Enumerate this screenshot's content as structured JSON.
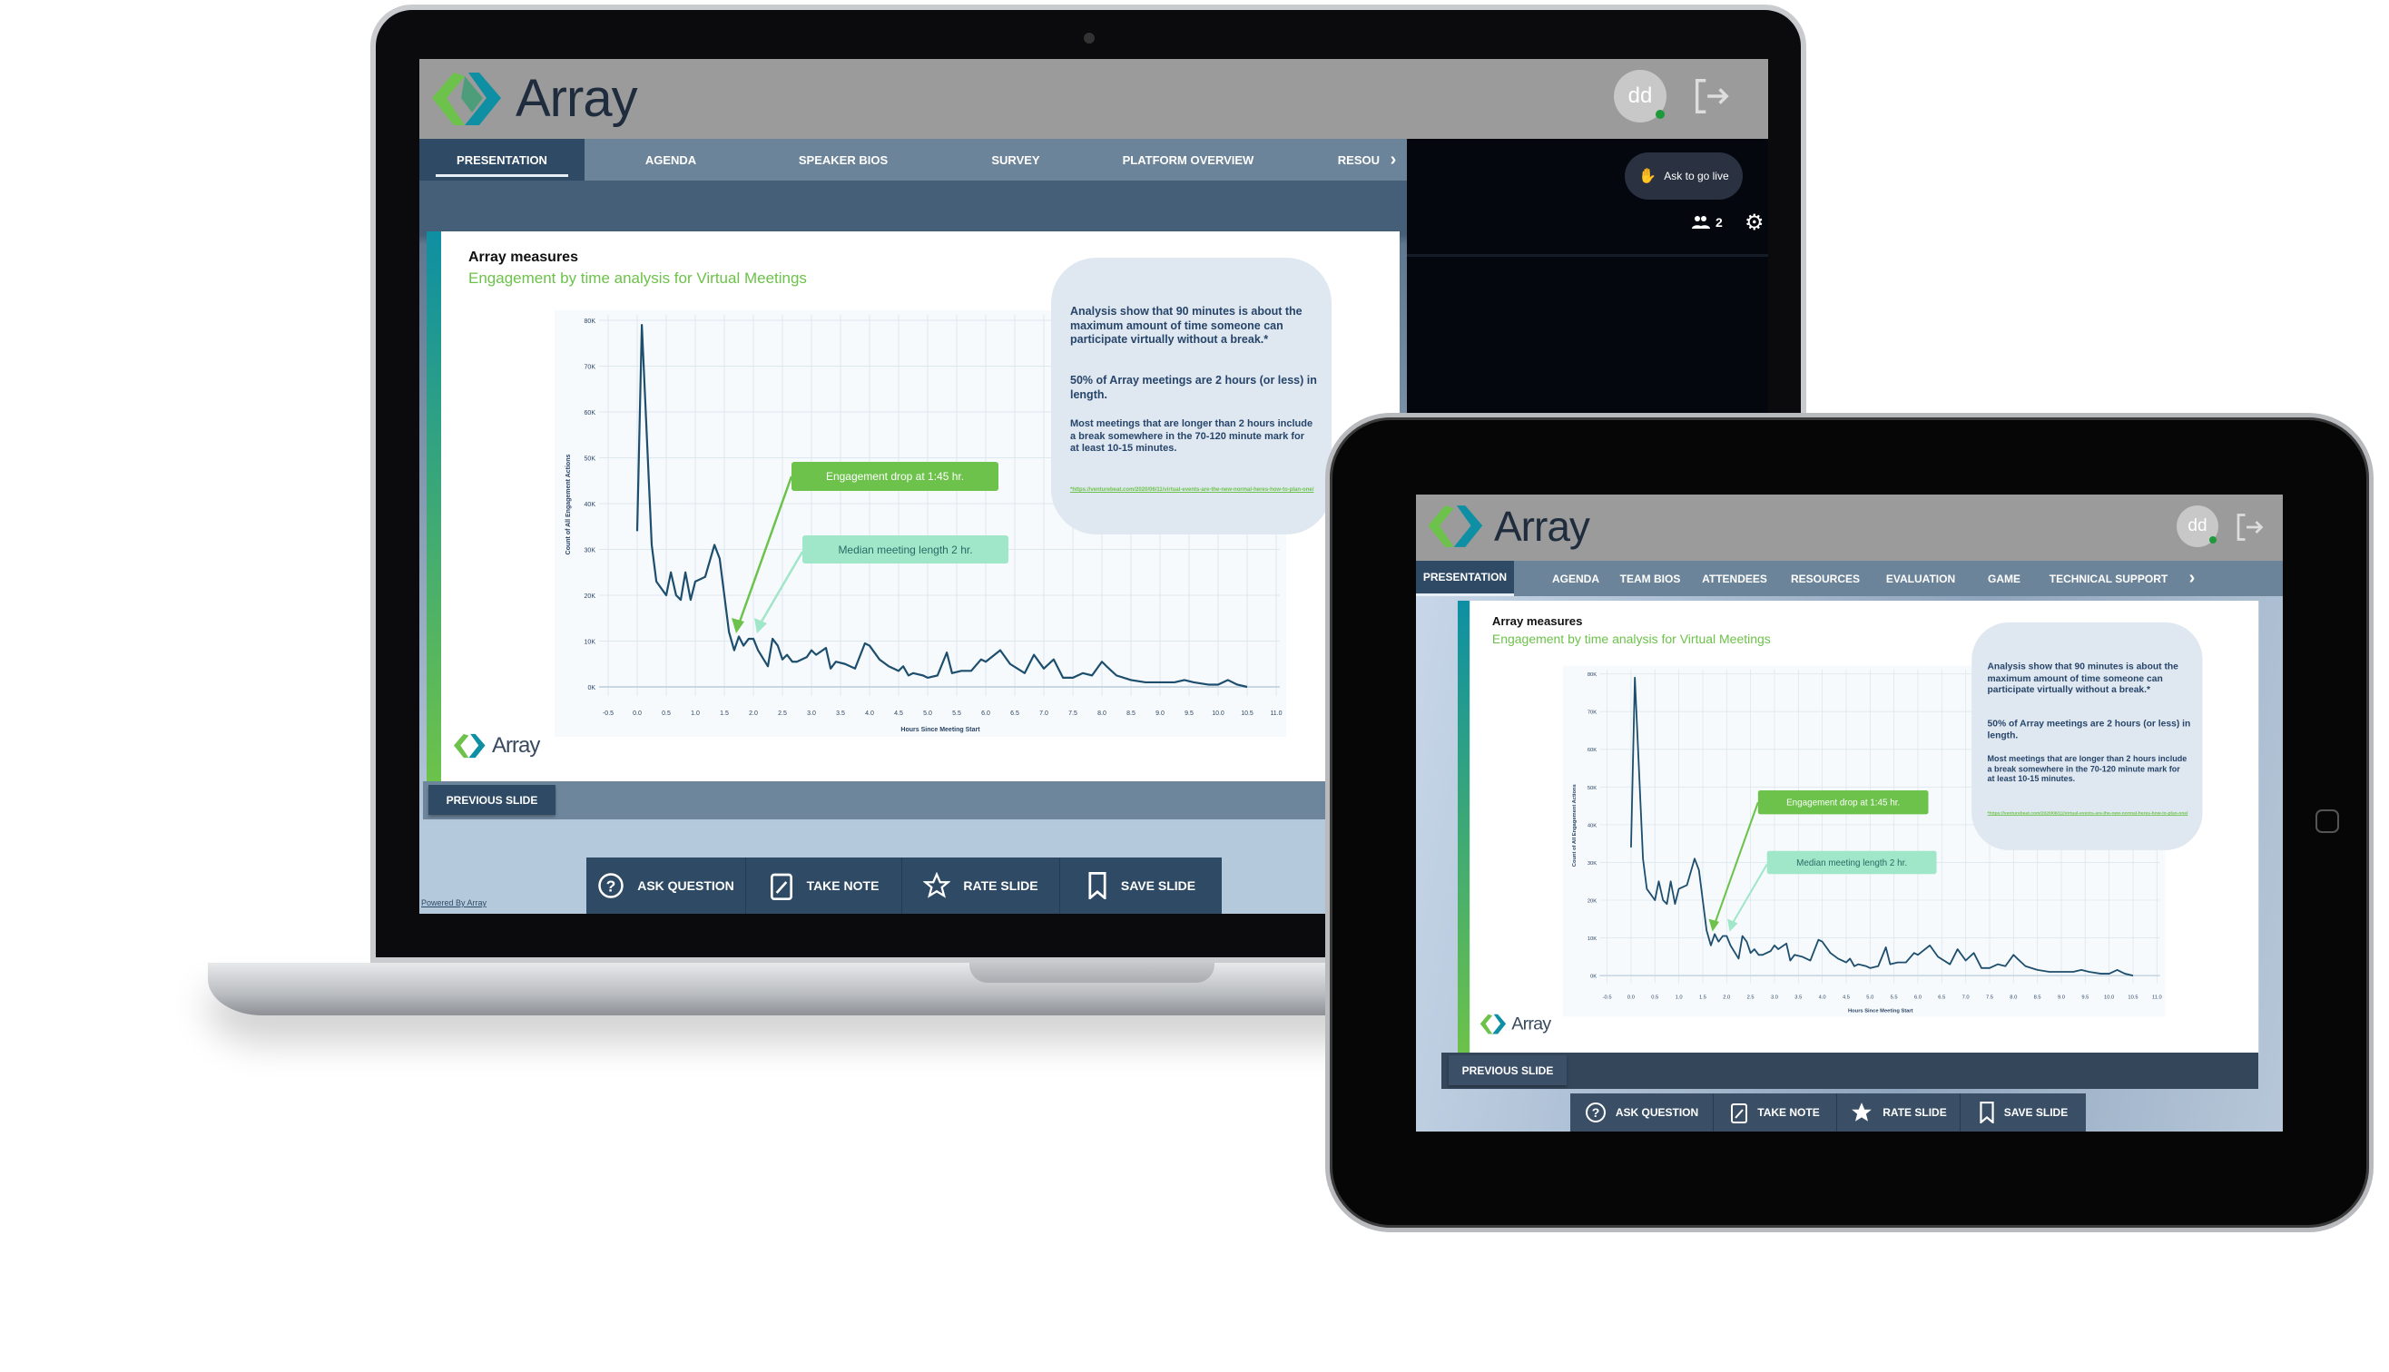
{
  "brand": {
    "name": "Array",
    "accent_green": "#6cc24a",
    "accent_teal": "#0e8fa3",
    "navy": "#2f4a64"
  },
  "user": {
    "initials": "dd",
    "status": "online"
  },
  "laptop": {
    "tabs": [
      "PRESENTATION",
      "AGENDA",
      "SPEAKER BIOS",
      "SURVEY",
      "PLATFORM OVERVIEW",
      "RESOU"
    ],
    "active_tab": "PRESENTATION",
    "ask_live": "Ask to go live",
    "participants": "2",
    "powered_by": "Powered By Array"
  },
  "tablet": {
    "tabs": [
      "PRESENTATION",
      "AGENDA",
      "TEAM BIOS",
      "ATTENDEES",
      "RESOURCES",
      "EVALUATION",
      "GAME",
      "TECHNICAL SUPPORT"
    ],
    "active_tab": "PRESENTATION"
  },
  "controls": {
    "previous": "PREVIOUS SLIDE",
    "ask": "ASK QUESTION",
    "note": "TAKE NOTE",
    "rate": "RATE SLIDE",
    "save": "SAVE SLIDE"
  },
  "slide": {
    "title": "Array measures",
    "subtitle": "Engagement by time analysis for Virtual Meetings",
    "callout": {
      "p1": "Analysis show that 90 minutes is about the maximum amount of time someone can participate virtually without a break.*",
      "p2": "50% of Array meetings are 2 hours (or less) in length.",
      "p3": "Most meetings that are longer than 2 hours include a break somewhere in the 70-120 minute mark for at least 10-15 minutes.",
      "link": "*https://venturebeat.com/2020/06/11/virtual-events-are-the-new-normal-heres-how-to-plan-one/"
    },
    "tag_drop": "Engagement drop at 1:45 hr.",
    "tag_median": "Median meeting length 2 hr."
  },
  "chart_data": {
    "type": "line",
    "xlabel": "Hours Since Meeting Start",
    "ylabel": "Count of All Engagement Actions",
    "xlim": [
      -0.5,
      11.0
    ],
    "ylim": [
      0,
      80000
    ],
    "xticks": [
      "-0.5",
      "0.0",
      "0.5",
      "1.0",
      "1.5",
      "2.0",
      "2.5",
      "3.0",
      "3.5",
      "4.0",
      "4.5",
      "5.0",
      "5.5",
      "6.0",
      "6.5",
      "7.0",
      "7.5",
      "8.0",
      "8.5",
      "9.0",
      "9.5",
      "10.0",
      "10.5",
      "11.0"
    ],
    "yticks": [
      "0K",
      "10K",
      "20K",
      "30K",
      "40K",
      "50K",
      "60K",
      "70K",
      "80K"
    ],
    "grid": true,
    "line_color": "#1d4e6e",
    "x": [
      0,
      0.08,
      0.25,
      0.33,
      0.5,
      0.58,
      0.67,
      0.75,
      0.83,
      0.92,
      1.0,
      1.17,
      1.33,
      1.42,
      1.58,
      1.67,
      1.75,
      1.83,
      1.92,
      2.0,
      2.08,
      2.25,
      2.33,
      2.42,
      2.5,
      2.58,
      2.67,
      2.75,
      2.92,
      3.0,
      3.08,
      3.25,
      3.33,
      3.42,
      3.58,
      3.75,
      3.92,
      4.0,
      4.17,
      4.33,
      4.5,
      4.58,
      4.67,
      4.75,
      4.92,
      5.0,
      5.17,
      5.33,
      5.42,
      5.58,
      5.75,
      5.92,
      6.0,
      6.25,
      6.42,
      6.67,
      6.83,
      7.0,
      7.17,
      7.33,
      7.5,
      7.67,
      7.83,
      8.0,
      8.08,
      8.25,
      8.5,
      8.75,
      9.0,
      9.25,
      9.42,
      9.58,
      9.83,
      10.0,
      10.17,
      10.33,
      10.5
    ],
    "y": [
      34000,
      79000,
      31000,
      23000,
      20000,
      25000,
      20000,
      19000,
      25000,
      19000,
      23000,
      24000,
      31000,
      28000,
      12000,
      8000,
      11000,
      9000,
      10500,
      10500,
      8000,
      4500,
      10500,
      9000,
      6000,
      7000,
      5500,
      5500,
      6500,
      8000,
      7000,
      8500,
      4000,
      5500,
      5000,
      4000,
      9500,
      9000,
      6000,
      4500,
      3500,
      4500,
      2500,
      3000,
      2500,
      2000,
      2500,
      7500,
      3000,
      3500,
      3500,
      6000,
      5500,
      8000,
      5000,
      3000,
      7000,
      4000,
      6000,
      2000,
      2000,
      3000,
      2500,
      5500,
      4500,
      2500,
      1500,
      1000,
      1000,
      1000,
      1500,
      1000,
      500,
      500,
      1500,
      500,
      0
    ],
    "annotations": [
      "Engagement drop at 1:45 hr.",
      "Median meeting length 2 hr."
    ]
  }
}
